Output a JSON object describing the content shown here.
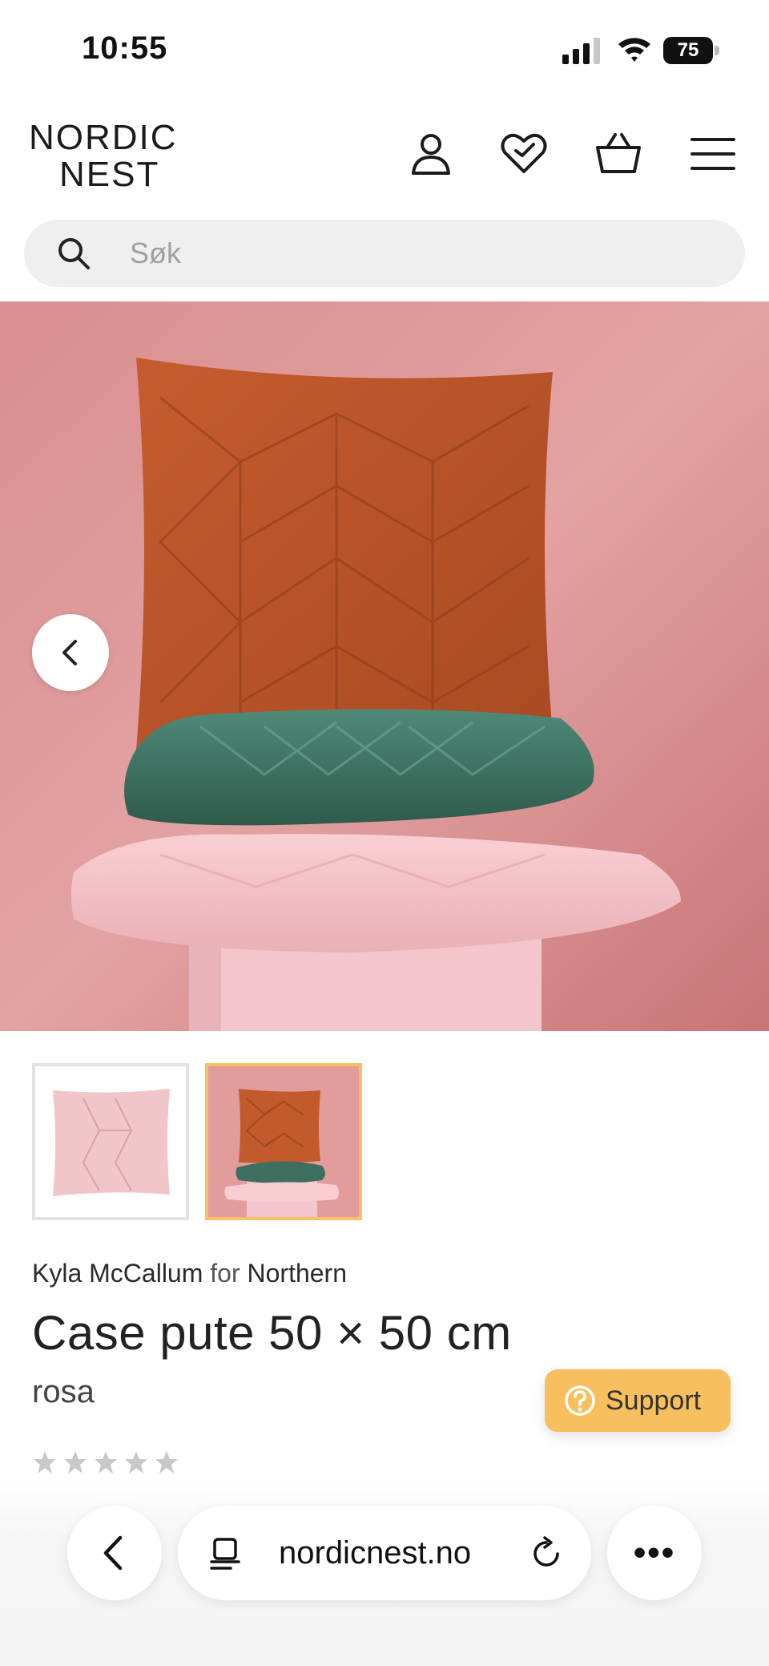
{
  "status_bar": {
    "time": "10:55",
    "battery": "75",
    "icons": [
      "cellular-signal-icon",
      "wifi-icon",
      "battery-icon"
    ]
  },
  "header": {
    "logo_line1": "NORDIC",
    "logo_line2": "NEST",
    "icons": [
      "account-icon",
      "wishlist-heart-icon",
      "basket-icon",
      "menu-icon"
    ]
  },
  "search": {
    "placeholder": "Søk",
    "value": ""
  },
  "gallery": {
    "active_thumbnail": 2,
    "thumbnail_count": 2,
    "prev_icon": "chevron-left-icon"
  },
  "product": {
    "designer": "Kyla McCallum",
    "for_text": "for",
    "brand": "Northern",
    "title": "Case pute 50 × 50 cm",
    "variant": "rosa",
    "rating": 0,
    "rating_max": 5
  },
  "support": {
    "label": "Support",
    "icon": "question-circle-icon"
  },
  "browser_toolbar": {
    "url": "nordicnest.no",
    "icons": [
      "back-arrow-icon",
      "reader-mode-icon",
      "reload-icon",
      "more-icon"
    ],
    "more_label": "•••"
  },
  "colors": {
    "accent_support": "#f7bf5e",
    "thumbnail_active_border": "#f5c165",
    "hero_background": "#d88a8a"
  }
}
